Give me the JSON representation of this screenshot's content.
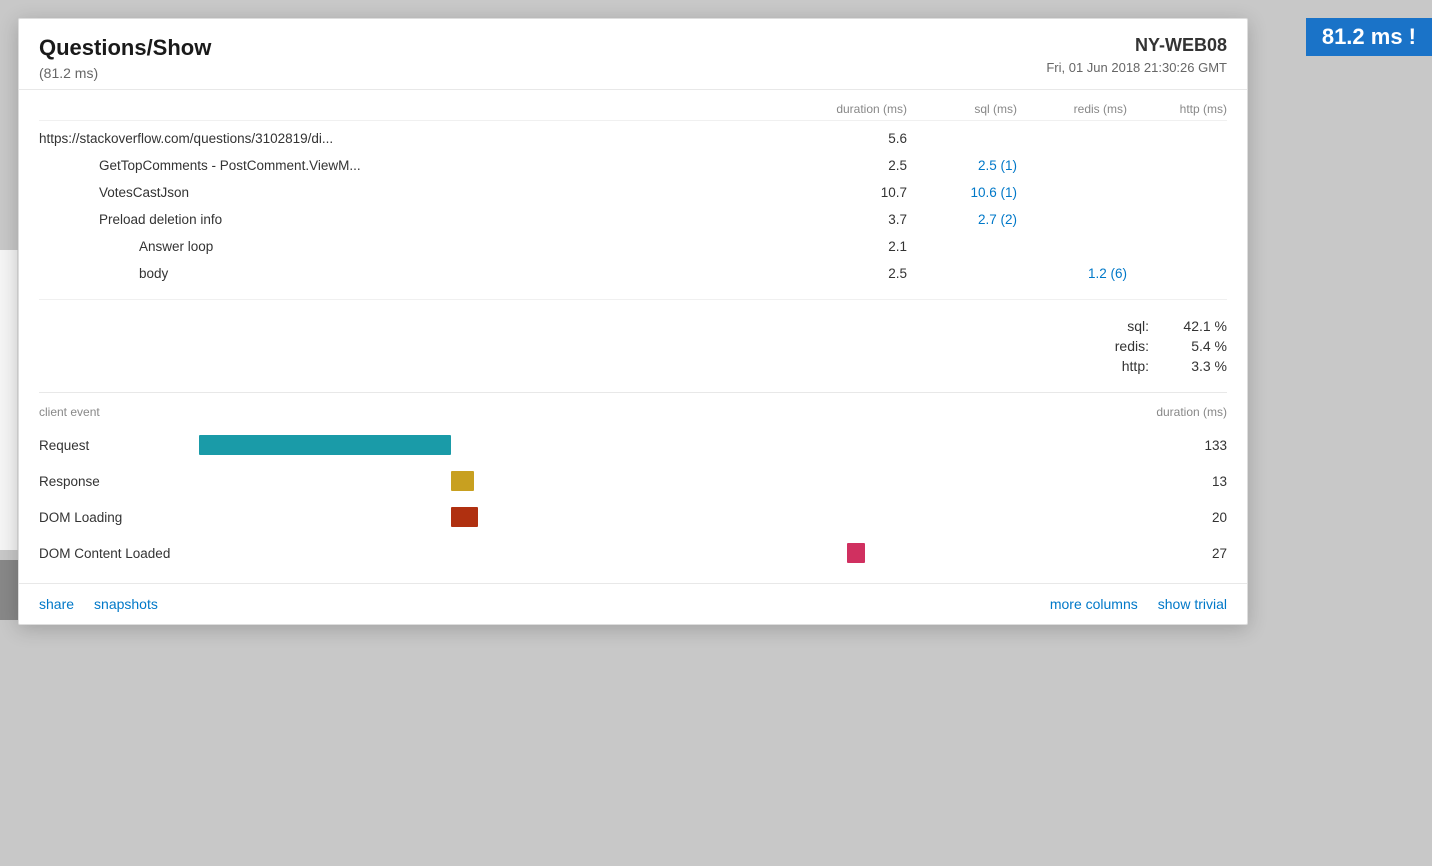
{
  "badge": {
    "label": "81.2 ms !"
  },
  "panel": {
    "title": "Questions/Show",
    "subtitle": "(81.2 ms)",
    "server": "NY-WEB08",
    "timestamp": "Fri, 01 Jun 2018 21:30:26 GMT",
    "columns": {
      "duration": "duration (ms)",
      "sql": "sql (ms)",
      "redis": "redis (ms)",
      "http": "http (ms)"
    },
    "rows": [
      {
        "label": "https://stackoverflow.com/questions/3102819/di...",
        "indent": 0,
        "duration": "5.6",
        "sql": "",
        "redis": "",
        "http": ""
      },
      {
        "label": "GetTopComments - PostComment.ViewM...",
        "indent": 1,
        "duration": "2.5",
        "sql": "2.5 (1)",
        "redis": "",
        "http": ""
      },
      {
        "label": "VotesCastJson",
        "indent": 1,
        "duration": "10.7",
        "sql": "10.6 (1)",
        "redis": "",
        "http": ""
      },
      {
        "label": "Preload deletion info",
        "indent": 1,
        "duration": "3.7",
        "sql": "2.7 (2)",
        "redis": "",
        "http": ""
      },
      {
        "label": "Answer loop",
        "indent": 2,
        "duration": "2.1",
        "sql": "",
        "redis": "",
        "http": ""
      },
      {
        "label": "body",
        "indent": 2,
        "duration": "2.5",
        "sql": "",
        "redis": "1.2 (6)",
        "http": ""
      }
    ],
    "summary": [
      {
        "label": "sql:",
        "value": "42.1 %"
      },
      {
        "label": "redis:",
        "value": "5.4 %"
      },
      {
        "label": "http:",
        "value": "3.3 %"
      }
    ],
    "client_header": {
      "event_label": "client event",
      "duration_label": "duration (ms)"
    },
    "client_rows": [
      {
        "label": "Request",
        "duration": "133",
        "bar_color": "#1a9ba8",
        "bar_left_pct": 0,
        "bar_width_pct": 28
      },
      {
        "label": "Response",
        "duration": "13",
        "bar_color": "#c8a020",
        "bar_left_pct": 28,
        "bar_width_pct": 2.5
      },
      {
        "label": "DOM Loading",
        "duration": "20",
        "bar_color": "#b03010",
        "bar_left_pct": 28,
        "bar_width_pct": 3
      },
      {
        "label": "DOM Content Loaded",
        "duration": "27",
        "bar_color": "#d03060",
        "bar_left_pct": 72,
        "bar_width_pct": 2
      }
    ],
    "footer": {
      "links_left": [
        {
          "key": "share",
          "label": "share"
        },
        {
          "key": "snapshots",
          "label": "snapshots"
        }
      ],
      "links_right": [
        {
          "key": "more-columns",
          "label": "more columns"
        },
        {
          "key": "show-trivial",
          "label": "show trivial"
        }
      ]
    }
  }
}
